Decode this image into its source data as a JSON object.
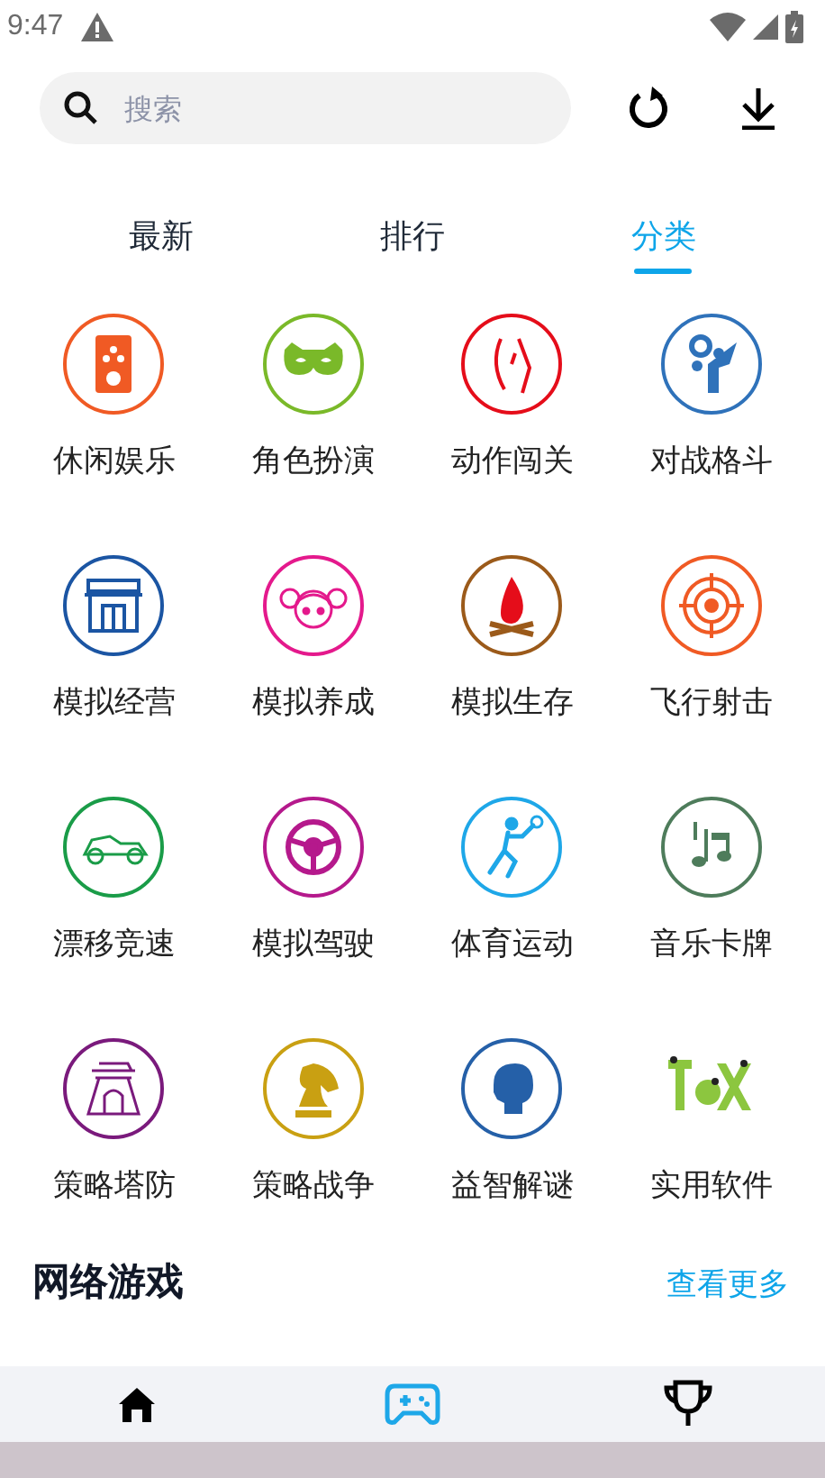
{
  "status_bar": {
    "time": "9:47"
  },
  "search": {
    "placeholder": "搜索"
  },
  "tabs": [
    {
      "label": "最新",
      "selected": false
    },
    {
      "label": "排行",
      "selected": false
    },
    {
      "label": "分类",
      "selected": true
    }
  ],
  "categories": [
    {
      "name": "休闲娱乐",
      "kind": "player",
      "color": "#f05a24"
    },
    {
      "name": "角色扮演",
      "kind": "mask",
      "color": "#7ab929"
    },
    {
      "name": "动作闯关",
      "kind": "blade",
      "color": "#e50d1a"
    },
    {
      "name": "对战格斗",
      "kind": "fighter",
      "color": "#2f72ba"
    },
    {
      "name": "模拟经营",
      "kind": "shop",
      "color": "#1b55a3"
    },
    {
      "name": "模拟养成",
      "kind": "girl",
      "color": "#e4198c"
    },
    {
      "name": "模拟生存",
      "kind": "fire",
      "color": "#9b5a1a"
    },
    {
      "name": "飞行射击",
      "kind": "target",
      "color": "#f05a24"
    },
    {
      "name": "漂移竞速",
      "kind": "car",
      "color": "#1a9c48"
    },
    {
      "name": "模拟驾驶",
      "kind": "wheel",
      "color": "#b5198c"
    },
    {
      "name": "体育运动",
      "kind": "runner",
      "color": "#1ea7e8"
    },
    {
      "name": "音乐卡牌",
      "kind": "music",
      "color": "#4e7c5b"
    },
    {
      "name": "策略塔防",
      "kind": "fort",
      "color": "#7a1a7c"
    },
    {
      "name": "策略战争",
      "kind": "knight",
      "color": "#c9a012"
    },
    {
      "name": "益智解谜",
      "kind": "head",
      "color": "#2560a8"
    },
    {
      "name": "实用软件",
      "kind": "tool",
      "color": "#8cc63f"
    }
  ],
  "section": {
    "title": "网络游戏",
    "more": "查看更多"
  },
  "bottom_nav": [
    {
      "kind": "home",
      "selected": false
    },
    {
      "kind": "game",
      "selected": true
    },
    {
      "kind": "trophy",
      "selected": false
    }
  ]
}
